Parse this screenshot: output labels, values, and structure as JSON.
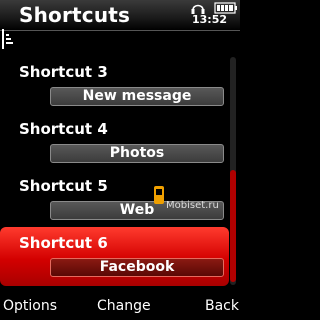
{
  "header": {
    "title": "Shortcuts",
    "clock": "13:52"
  },
  "list": [
    {
      "label": "Shortcut 3",
      "value": "New message"
    },
    {
      "label": "Shortcut 4",
      "value": "Photos"
    },
    {
      "label": "Shortcut 5",
      "value": "Web"
    },
    {
      "label": "Shortcut 6",
      "value": "Facebook",
      "selected": true
    }
  ],
  "watermark": {
    "text": "Mobiset.ru"
  },
  "softkeys": {
    "left": "Options",
    "middle": "Change",
    "right": "Back"
  },
  "colors": {
    "accent": "#d30000",
    "background": "#000000"
  }
}
